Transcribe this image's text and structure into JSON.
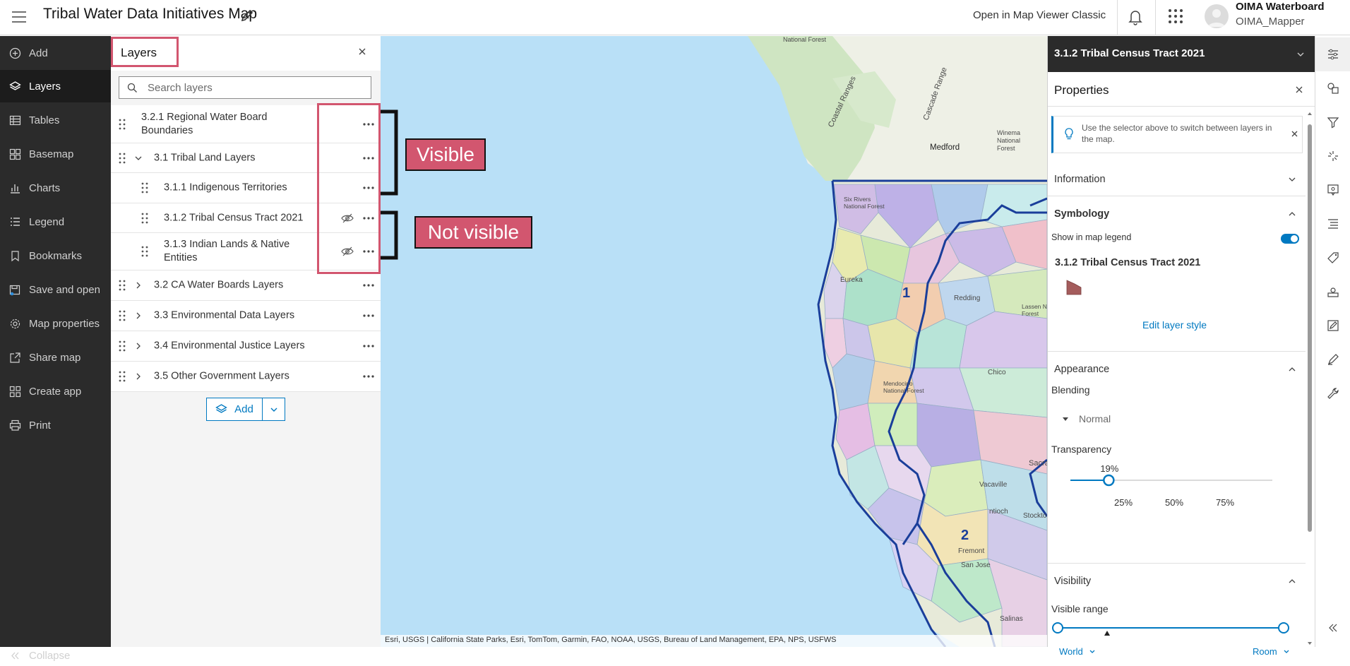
{
  "app": {
    "title": "Tribal Water Data Initiatives Map",
    "open_classic": "Open in Map Viewer Classic",
    "user_name": "OIMA Waterboard",
    "user_id": "OIMA_Mapper"
  },
  "nav": {
    "items": [
      {
        "label": "Add",
        "icon": "plus-circle-icon"
      },
      {
        "label": "Layers",
        "icon": "layers-icon"
      },
      {
        "label": "Tables",
        "icon": "table-icon"
      },
      {
        "label": "Basemap",
        "icon": "basemap-icon"
      },
      {
        "label": "Charts",
        "icon": "chart-icon"
      },
      {
        "label": "Legend",
        "icon": "legend-icon"
      },
      {
        "label": "Bookmarks",
        "icon": "bookmark-icon"
      },
      {
        "label": "Save and open",
        "icon": "save-icon"
      },
      {
        "label": "Map properties",
        "icon": "gear-icon"
      },
      {
        "label": "Share map",
        "icon": "share-icon"
      },
      {
        "label": "Create app",
        "icon": "apps-icon"
      },
      {
        "label": "Print",
        "icon": "print-icon"
      }
    ],
    "collapse": "Collapse"
  },
  "layers": {
    "title": "Layers",
    "search_placeholder": "Search layers",
    "rows": [
      {
        "name_line1": "3.2.1 Regional Water Board",
        "name_line2": "Boundaries",
        "level": 0,
        "expander": "none",
        "hidden": false
      },
      {
        "name": "3.1 Tribal Land Layers",
        "level": 0,
        "expander": "open",
        "hidden": false
      },
      {
        "name": "3.1.1 Indigenous Territories",
        "level": 1,
        "expander": "none",
        "hidden": false
      },
      {
        "name": "3.1.2 Tribal Census Tract 2021",
        "level": 1,
        "expander": "none",
        "hidden": true
      },
      {
        "name_line1": "3.1.3 Indian Lands & Native",
        "name_line2": "Entities",
        "level": 1,
        "expander": "none",
        "hidden": true
      },
      {
        "name": "3.2 CA Water Boards Layers",
        "level": 0,
        "expander": "closed",
        "hidden": false
      },
      {
        "name": "3.3 Environmental Data Layers",
        "level": 0,
        "expander": "closed",
        "hidden": false
      },
      {
        "name": "3.4 Environmental Justice Layers",
        "level": 0,
        "expander": "closed",
        "hidden": false
      },
      {
        "name": "3.5 Other Government Layers",
        "level": 0,
        "expander": "closed",
        "hidden": false
      }
    ],
    "add_label": "Add"
  },
  "annotations": {
    "visible": "Visible",
    "not_visible": "Not visible"
  },
  "map": {
    "labels": {
      "national_forest": "National Forest",
      "coastal_ranges": "Coastal Ranges",
      "cascade_range": "Cascade Range",
      "medford": "Medford",
      "winema_1": "Winema",
      "winema_2": "National",
      "winema_3": "Forest",
      "six_rivers_1": "Six Rivers",
      "six_rivers_2": "National Forest",
      "eureka": "Eureka",
      "redding": "Redding",
      "lassen_1": "Lassen N",
      "lassen_2": "Forest",
      "chico": "Chico",
      "mendocino_1": "Mendocino",
      "mendocino_2": "National Forest",
      "vacaville": "Vacaville",
      "sacramento": "Sacrame",
      "antioch": "ntioch",
      "stockton": "Stockto",
      "fremont": "Fremont",
      "san_jose": "San Jose",
      "salinas": "Salinas",
      "region_1": "1",
      "region_2": "2"
    },
    "attribution": "Esri, USGS | California State Parks, Esri, TomTom, Garmin, FAO, NOAA, USGS, Bureau of Land Management, EPA, NPS, USFWS"
  },
  "properties": {
    "layer_selector": "3.1.2 Tribal Census Tract 2021",
    "title": "Properties",
    "notice": "Use the selector above to switch between layers in the map.",
    "information": "Information",
    "symbology": "Symbology",
    "show_in_legend": "Show in map legend",
    "show_in_legend_on": true,
    "layer_name": "3.1.2 Tribal Census Tract 2021",
    "swatch_color": "#a45c5c",
    "edit_style": "Edit layer style",
    "appearance": "Appearance",
    "blending": "Blending",
    "blending_value": "Normal",
    "transparency": "Transparency",
    "transparency_value": "19%",
    "transparency_percent": 19,
    "ticks": [
      "25%",
      "50%",
      "75%"
    ],
    "visibility": "Visibility",
    "visible_range": "Visible range",
    "range_min": "World",
    "range_max": "Room"
  },
  "colors": {
    "accent": "#0079c1",
    "annotation": "#d2566f",
    "nav_bg": "#2b2b2b",
    "water": "#b9e0f7"
  },
  "toolbar": {
    "icons": [
      "sliders-icon",
      "shapes-icon",
      "filter-icon",
      "effects-icon",
      "popup-icon",
      "fields-icon",
      "labels-icon",
      "forms-icon",
      "sketch-icon",
      "measure-icon",
      "wrench-icon"
    ]
  }
}
